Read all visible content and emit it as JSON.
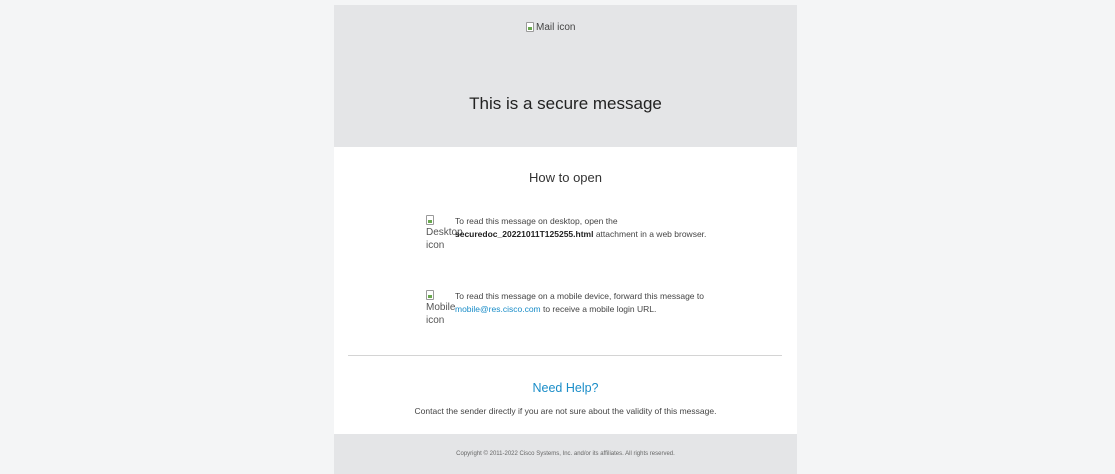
{
  "header": {
    "mail_icon_alt": "Mail icon",
    "title": "This is a secure message"
  },
  "how_to_open": {
    "title": "How to open",
    "desktop": {
      "icon_alt_line1": "Desktop",
      "icon_alt_line2": "icon",
      "text_before": "To read this message on desktop, open the ",
      "attachment_name": "securedoc_20221011T125255.html",
      "text_after": " attachment in a web browser."
    },
    "mobile": {
      "icon_alt_line1": "Mobile",
      "icon_alt_line2": "icon",
      "text_before": "To read this message on a mobile device, forward this message to ",
      "email": "mobile@res.cisco.com",
      "text_after": " to receive a mobile login URL."
    }
  },
  "help": {
    "title": "Need Help?",
    "contact_text": "Contact the sender directly if you are not sure about the validity of this message."
  },
  "footer": {
    "copyright": "Copyright © 2011-2022 Cisco Systems, Inc. and/or its affiliates. All rights reserved."
  },
  "colors": {
    "page_bg": "#f4f5f6",
    "header_bg": "#e4e5e7",
    "link": "#1a8dc8"
  },
  "icons": [
    "mail-icon",
    "desktop-icon",
    "mobile-icon"
  ]
}
